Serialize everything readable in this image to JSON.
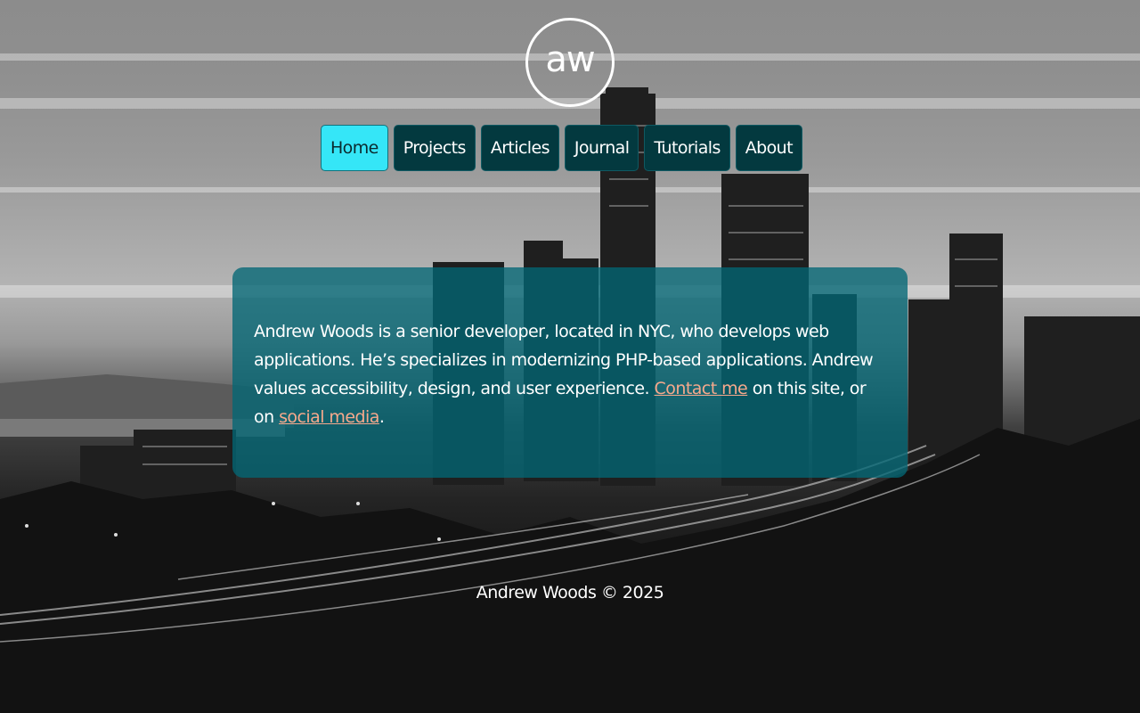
{
  "logo": {
    "text": "aw"
  },
  "nav": {
    "items": [
      {
        "label": "Home",
        "active": true
      },
      {
        "label": "Projects",
        "active": false
      },
      {
        "label": "Articles",
        "active": false
      },
      {
        "label": "Journal",
        "active": false
      },
      {
        "label": "Tutorials",
        "active": false
      },
      {
        "label": "About",
        "active": false
      }
    ]
  },
  "intro": {
    "text_1": "Andrew Woods is a senior developer, located in NYC, who develops web applications. He’s specializes in modernizing PHP-based applications. Andrew values accessibility, design, and user experience. ",
    "contact_link": "Contact me",
    "text_2": " on this site, or on ",
    "social_link": "social media",
    "text_3": "."
  },
  "footer": {
    "text": "Andrew Woods © 2025"
  },
  "colors": {
    "nav_bg": "#03393f",
    "nav_active_bg": "#35e6f7",
    "card_bg": "#026775",
    "link": "#f7a98c"
  },
  "icons": {
    "logo": "aw-monogram-circle"
  }
}
